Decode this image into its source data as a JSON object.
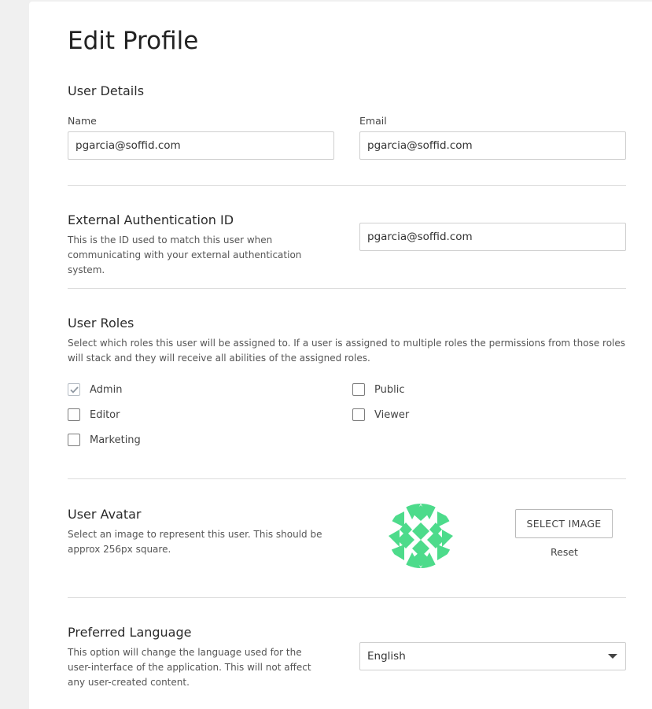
{
  "page": {
    "title": "Edit Profile"
  },
  "user_details": {
    "heading": "User Details",
    "name_label": "Name",
    "name_value": "pgarcia@soffid.com",
    "email_label": "Email",
    "email_value": "pgarcia@soffid.com"
  },
  "external_auth": {
    "heading": "External Authentication ID",
    "description": "This is the ID used to match this user when communicating with your external authentication system.",
    "value": "pgarcia@soffid.com"
  },
  "user_roles": {
    "heading": "User Roles",
    "description": "Select which roles this user will be assigned to. If a user is assigned to multiple roles the permissions from those roles will stack and they will receive all abilities of the assigned roles.",
    "roles": [
      {
        "label": "Admin",
        "checked": true
      },
      {
        "label": "Public",
        "checked": false
      },
      {
        "label": "Editor",
        "checked": false
      },
      {
        "label": "Viewer",
        "checked": false
      },
      {
        "label": "Marketing",
        "checked": false
      }
    ]
  },
  "user_avatar": {
    "heading": "User Avatar",
    "description": "Select an image to represent this user. This should be approx 256px square.",
    "select_label": "SELECT IMAGE",
    "reset_label": "Reset",
    "avatar_color": "#4ddb8b"
  },
  "preferred_language": {
    "heading": "Preferred Language",
    "description": "This option will change the language used for the user-interface of the application. This will not affect any user-created content.",
    "selected": "English"
  },
  "icons": {
    "check": "check-icon",
    "dropdown": "caret-down-icon"
  }
}
